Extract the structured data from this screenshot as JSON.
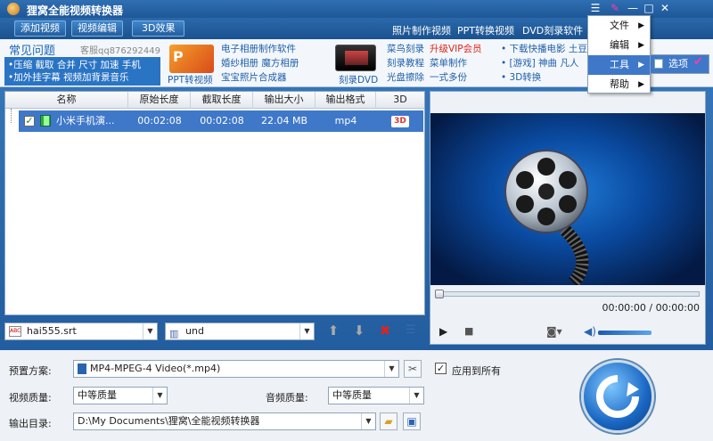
{
  "app": {
    "title": "狸窝全能视频转换器"
  },
  "toolbar": {
    "add_video": "添加视频",
    "edit_video": "视频编辑",
    "effect_3d": "3D效果",
    "links": [
      "照片制作视频",
      "PPT转换视频",
      "DVD刻录软件"
    ]
  },
  "ads": {
    "faq_title": "常见问题",
    "qq": "客服qq876292449",
    "faq_line1": "•压缩 截取 合并 尺寸 加速 手机",
    "faq_line2": "•加外挂字幕 视频加背景音乐",
    "ppt_label": "PPT转视频",
    "col1": [
      "电子相册制作软件",
      "婚纱相册 魔方相册",
      "宝宝照片合成器"
    ],
    "dvd_label": "刻录DVD",
    "col2a": [
      "菜鸟刻录",
      "刻录教程",
      "光盘擦除"
    ],
    "col2b": [
      "升级VIP会员",
      "菜单制作",
      "一式多份"
    ],
    "col3": [
      "• 下载快播电影 土豆",
      "• [游戏] 神曲 凡人",
      "• 3D转换"
    ]
  },
  "filelist": {
    "headers": [
      "名称",
      "原始长度",
      "截取长度",
      "输出大小",
      "输出格式",
      "3D"
    ],
    "rows": [
      {
        "name": "小米手机演...",
        "orig": "00:02:08",
        "cut": "00:02:08",
        "size": "22.04 MB",
        "format": "mp4",
        "three_d": "3D"
      }
    ]
  },
  "subtitle": {
    "file": "hai555.srt",
    "audio": "und"
  },
  "preview": {
    "time": "00:00:00 / 00:00:00"
  },
  "settings": {
    "preset_label": "预置方案:",
    "preset_value": "MP4-MPEG-4 Video(*.mp4)",
    "apply_all": "应用到所有",
    "video_quality_label": "视频质量:",
    "video_quality": "中等质量",
    "audio_quality_label": "音频质量:",
    "audio_quality": "中等质量",
    "output_label": "输出目录:",
    "output_path": "D:\\My Documents\\狸窝\\全能视频转换器"
  },
  "menu": {
    "items": [
      "文件",
      "编辑",
      "工具",
      "帮助"
    ],
    "submenu_item": "选项"
  },
  "colors": {
    "selection": "#3f78c8",
    "titlebar": "#1d5798",
    "link_red": "#e0241b"
  }
}
